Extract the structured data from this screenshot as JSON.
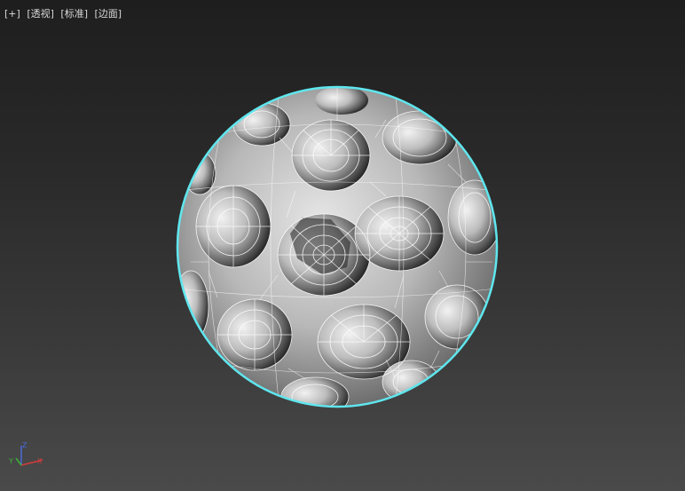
{
  "viewport": {
    "labels": [
      "[+]",
      "[透视]",
      "[标准]",
      "[边面]"
    ]
  },
  "model": {
    "name": "perforated-sphere-mesh",
    "selection_outline_color": "#5fe6ee",
    "wire_color": "#ffffff",
    "shade_color": "#a0a0a0"
  },
  "gizmo": {
    "axes": [
      "X",
      "Y",
      "Z"
    ],
    "x_color": "#d23c3c",
    "y_color": "#3cb43c",
    "z_color": "#4a6ad8"
  }
}
